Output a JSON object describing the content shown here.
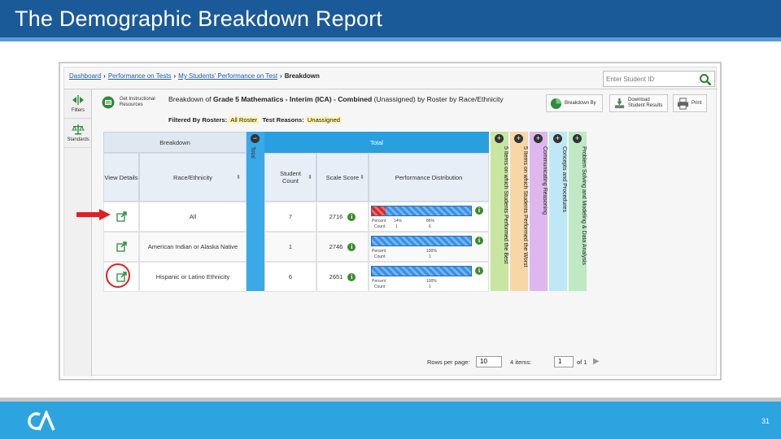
{
  "slide": {
    "title": "The Demographic Breakdown Report",
    "page_number": "31"
  },
  "app": {
    "breadcrumb": [
      "Dashboard",
      "Performance on Tests",
      "My Students' Performance on Test",
      "Breakdown"
    ],
    "search_placeholder": "Enter Student ID",
    "rail": [
      {
        "label": "Filters",
        "icon": "filter-arrows-icon"
      },
      {
        "label": "Standards",
        "icon": "scales-icon"
      }
    ],
    "toolbar": {
      "instructional_label_1": "Get Instructional",
      "instructional_label_2": "Resources",
      "breakdown_by": "Breakdown By",
      "download_1": "Download",
      "download_2": "Student Results",
      "print": "Print"
    },
    "heading": {
      "prefix": "Breakdown of ",
      "bold": "Grade 5 Mathematics - Interim (ICA) - Combined",
      "suffix": " (Unassigned) by Roster by Race/Ethnicity"
    },
    "filters": {
      "rosters_label": "Filtered By Rosters:",
      "rosters_value": "All Roster",
      "reasons_label": "Test Reasons:",
      "reasons_value": "Unassigned"
    },
    "table": {
      "group_breakdown": "Breakdown",
      "group_total": "Total",
      "total_collapsed": "Total",
      "columns": [
        "View Details",
        "Race/Ethnicity",
        "Student Count",
        "Scale Score",
        "Performance Distribution"
      ],
      "rows": [
        {
          "name": "All",
          "count": "7",
          "score": "2716",
          "percent_label": "Percent",
          "count_label": "Count",
          "seg1_pct": "14%",
          "seg1_cnt": "1",
          "seg2_pct": "86%",
          "seg2_cnt": "6",
          "red_fraction": 0.14
        },
        {
          "name": "American Indian or Alaska Native",
          "count": "1",
          "score": "2746",
          "percent_label": "Percent",
          "count_label": "Count",
          "seg1_pct": "",
          "seg1_cnt": "",
          "seg2_pct": "100%",
          "seg2_cnt": "1",
          "red_fraction": 0
        },
        {
          "name": "Hispanic or Latino Ethnicity",
          "count": "6",
          "score": "2651",
          "percent_label": "Percent",
          "count_label": "Count",
          "seg1_pct": "",
          "seg1_cnt": "",
          "seg2_pct": "100%",
          "seg2_cnt": "1",
          "red_fraction": 0
        }
      ],
      "claim_strips": [
        {
          "label": "5 Items on which Students Performed the Best",
          "color": "#c8e6a0",
          "icon": "plus-icon"
        },
        {
          "label": "5 Items on which Students Performed the Worst",
          "color": "#f7d7a8",
          "icon": "plus-icon"
        },
        {
          "label": "Communicating Reasoning",
          "color": "#ddb8ee",
          "icon": "plus-icon"
        },
        {
          "label": "Concepts and Procedures",
          "color": "#bfe8f6",
          "icon": "plus-icon"
        },
        {
          "label": "Problem Solving and Modeling & Data Analysis",
          "color": "#bfe9c4",
          "icon": "plus-icon"
        }
      ]
    },
    "pager": {
      "rows_label": "Rows per page:",
      "rows_value": "10",
      "items_label": "4 items:",
      "page_value": "1",
      "of_label": "of 1"
    }
  },
  "colors": {
    "title_bar": "#1b5a99",
    "footer": "#2da3e0",
    "annotation": "#e02020",
    "total_band": "#2a9fe0"
  }
}
